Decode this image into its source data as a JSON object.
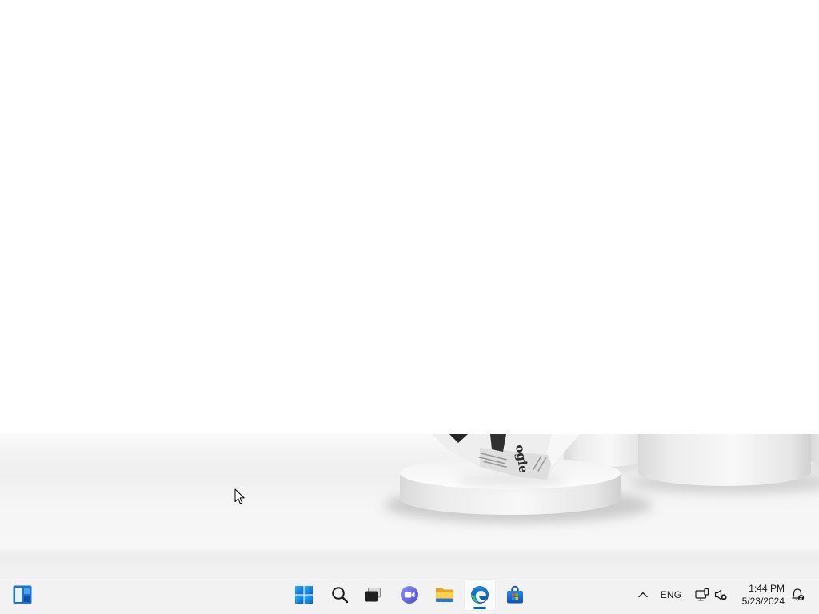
{
  "colors": {
    "window_background": "#ffffff",
    "taskbar_background": "#f2f2f2",
    "taskbar_border": "#dcdcdc",
    "text": "#1a1a1a",
    "active_indicator": "#0067c0",
    "active_button_background": "#fbfbfb"
  },
  "desktop": {
    "wallpaper": {
      "print_text": "ogie"
    }
  },
  "cursor": {
    "icon": "arrow-cursor-icon"
  },
  "taskbar": {
    "widgets": {
      "icon": "widgets-icon",
      "active": false
    },
    "pinned_apps": [
      {
        "icon": "windows-start-icon",
        "active": false
      },
      {
        "icon": "search-icon",
        "active": false
      },
      {
        "icon": "task-view-icon",
        "active": false
      },
      {
        "icon": "chat-icon",
        "active": false
      },
      {
        "icon": "file-explorer-icon",
        "active": false
      },
      {
        "icon": "edge-browser-icon",
        "active": true
      },
      {
        "icon": "microsoft-store-icon",
        "active": false
      }
    ],
    "tray": {
      "overflow_icon": "chevron-up-icon",
      "language": "ENG",
      "network_icon": "network-icon",
      "volume_icon": "volume-muted-icon",
      "time": "1:44 PM",
      "date": "5/23/2024",
      "notifications_icon": "notification-bell-icon"
    }
  }
}
